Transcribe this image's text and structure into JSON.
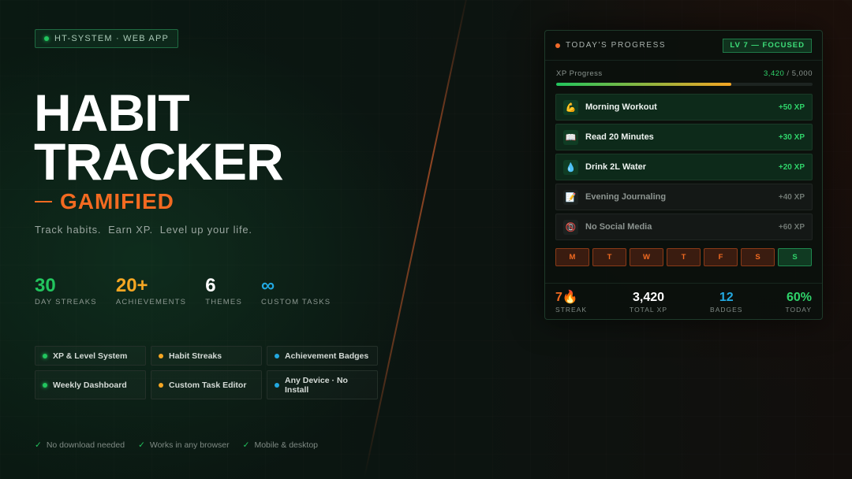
{
  "badge": {
    "text": "HT-SYSTEM · WEB APP"
  },
  "hero": {
    "title_line1": "HABIT",
    "title_line2": "TRACKER",
    "subtitle": "GAMIFIED",
    "tagline": "Track habits.  Earn XP.  Level up your life."
  },
  "stats": [
    {
      "value": "30",
      "label": "DAY STREAKS",
      "color": "#22c55e"
    },
    {
      "value": "20+",
      "label": "ACHIEVEMENTS",
      "color": "#f5a623"
    },
    {
      "value": "6",
      "label": "THEMES",
      "color": "#ffffff"
    },
    {
      "value": "∞",
      "label": "CUSTOM TASKS",
      "color": "#22a8e0"
    }
  ],
  "features": [
    {
      "label": "XP & Level System",
      "color": "green"
    },
    {
      "label": "Habit Streaks",
      "color": "orange"
    },
    {
      "label": "Achievement Badges",
      "color": "blue"
    },
    {
      "label": "Weekly Dashboard",
      "color": "green"
    },
    {
      "label": "Custom Task Editor",
      "color": "orange"
    },
    {
      "label": "Any Device · No Install",
      "color": "blue"
    }
  ],
  "checks": [
    "No download needed",
    "Works in any browser",
    "Mobile & desktop"
  ],
  "panel": {
    "header": "TODAY'S PROGRESS",
    "level": "LV 7 — FOCUSED",
    "xp_label": "XP Progress",
    "xp_current": "3,420",
    "xp_total": " / 5,000",
    "xp_fraction": 0.684,
    "tasks": [
      {
        "icon": "muscle-icon",
        "glyph": "💪",
        "name": "Morning Workout",
        "xp": "+50 XP",
        "done": true
      },
      {
        "icon": "book-icon",
        "glyph": "📖",
        "name": "Read 20 Minutes",
        "xp": "+30 XP",
        "done": true
      },
      {
        "icon": "water-drop-icon",
        "glyph": "💧",
        "name": "Drink 2L Water",
        "xp": "+20 XP",
        "done": true
      },
      {
        "icon": "memo-icon",
        "glyph": "📝",
        "name": "Evening Journaling",
        "xp": "+40 XP",
        "done": false
      },
      {
        "icon": "no-phone-icon",
        "glyph": "📵",
        "name": "No Social Media",
        "xp": "+60 XP",
        "done": false
      }
    ],
    "days": [
      {
        "label": "M",
        "today": false
      },
      {
        "label": "T",
        "today": false
      },
      {
        "label": "W",
        "today": false
      },
      {
        "label": "T",
        "today": false
      },
      {
        "label": "F",
        "today": false
      },
      {
        "label": "S",
        "today": false
      },
      {
        "label": "S",
        "today": true
      }
    ],
    "footer": [
      {
        "value": "7🔥",
        "label": "STREAK",
        "color": "#f26a21"
      },
      {
        "value": "3,420",
        "label": "TOTAL XP",
        "color": "#ffffff"
      },
      {
        "value": "12",
        "label": "BADGES",
        "color": "#22a8e0"
      },
      {
        "value": "60%",
        "label": "TODAY",
        "color": "#2fd36a"
      }
    ]
  }
}
